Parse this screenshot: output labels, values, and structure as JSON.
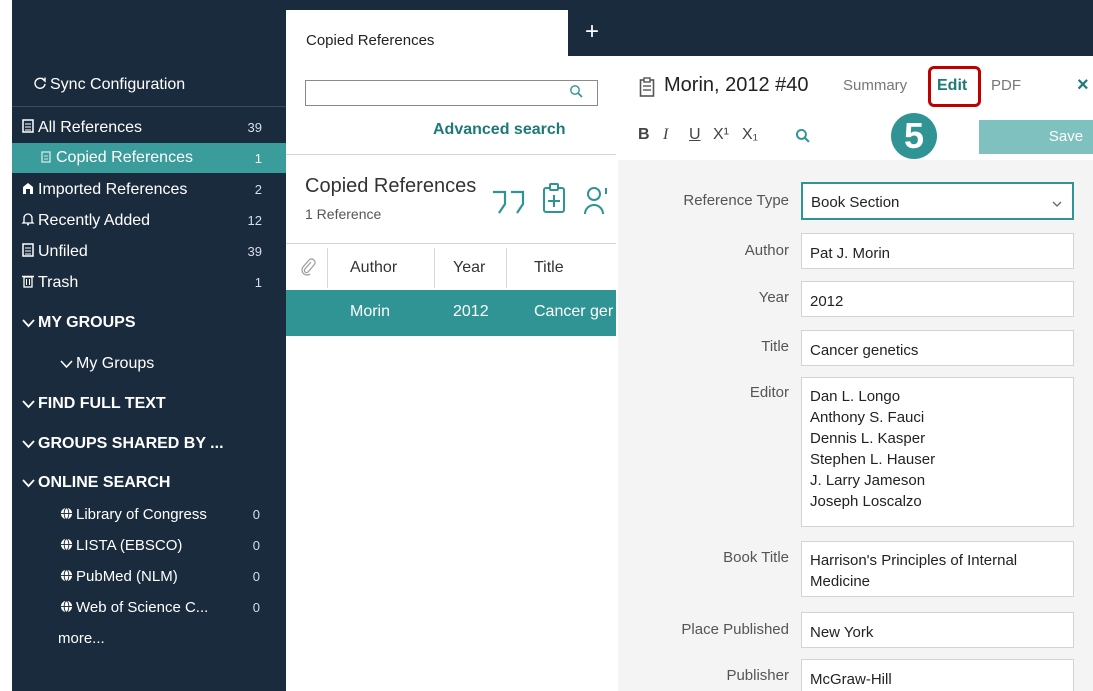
{
  "sidebar": {
    "sync": {
      "icon": "sync-icon",
      "label": "Sync Configuration"
    },
    "items": [
      {
        "icon": "document-icon",
        "label": "All References",
        "count": "39"
      },
      {
        "icon": "document-icon",
        "label": "Copied References",
        "count": "1",
        "active": true
      },
      {
        "icon": "imported-icon",
        "label": "Imported References",
        "count": "2"
      },
      {
        "icon": "bell-icon",
        "label": "Recently Added",
        "count": "12"
      },
      {
        "icon": "document-icon",
        "label": "Unfiled",
        "count": "39"
      },
      {
        "icon": "trash-icon",
        "label": "Trash",
        "count": "1"
      }
    ],
    "my_groups_header": "MY GROUPS",
    "my_groups_sub": "My Groups",
    "find_full_text_header": "FIND FULL TEXT",
    "groups_shared_header": "GROUPS SHARED BY ...",
    "online_search_header": "ONLINE SEARCH",
    "online_search_items": [
      {
        "icon": "globe-icon",
        "label": "Library of Congress",
        "count": "0"
      },
      {
        "icon": "globe-icon",
        "label": "LISTA (EBSCO)",
        "count": "0"
      },
      {
        "icon": "globe-icon",
        "label": "PubMed (NLM)",
        "count": "0"
      },
      {
        "icon": "globe-icon",
        "label": "Web of Science C...",
        "count": "0"
      }
    ],
    "more": "more..."
  },
  "middle": {
    "tab_label": "Copied References",
    "plus": "+",
    "search": {
      "value": "",
      "placeholder": ""
    },
    "advanced_search": "Advanced search",
    "group_title": "Copied References",
    "group_count": "1 Reference",
    "columns": [
      "Author",
      "Year",
      "Title"
    ],
    "rows": [
      {
        "author": "Morin",
        "year": "2012",
        "title": "Cancer ger"
      }
    ]
  },
  "reference": {
    "title": "Morin, 2012 #40",
    "tabs": {
      "summary": "Summary",
      "edit": "Edit",
      "pdf": "PDF"
    },
    "close": "×",
    "format_buttons": {
      "bold": "B",
      "italic": "I",
      "underline": "U",
      "superscript": "X¹",
      "subscript": "X₁"
    },
    "step_badge": "5",
    "save": "Save",
    "fields": {
      "reference_type": {
        "label": "Reference Type",
        "value": "Book Section"
      },
      "author": {
        "label": "Author",
        "value": "Pat J. Morin"
      },
      "year": {
        "label": "Year",
        "value": "2012"
      },
      "title": {
        "label": "Title",
        "value": "Cancer genetics"
      },
      "editor": {
        "label": "Editor",
        "values": [
          "Dan L. Longo",
          "Anthony S. Fauci",
          "Dennis L. Kasper",
          "Stephen L. Hauser",
          "J. Larry Jameson",
          "Joseph Loscalzo"
        ]
      },
      "book_title": {
        "label": "Book Title",
        "values": [
          "Harrison's Principles of Internal",
          "Medicine"
        ]
      },
      "place_published": {
        "label": "Place Published",
        "value": "New York"
      },
      "publisher": {
        "label": "Publisher",
        "value": "McGraw-Hill"
      }
    }
  },
  "colors": {
    "sidebar_bg": "#1b2b3e",
    "accent": "#2f9493",
    "highlight": "#c00000"
  }
}
